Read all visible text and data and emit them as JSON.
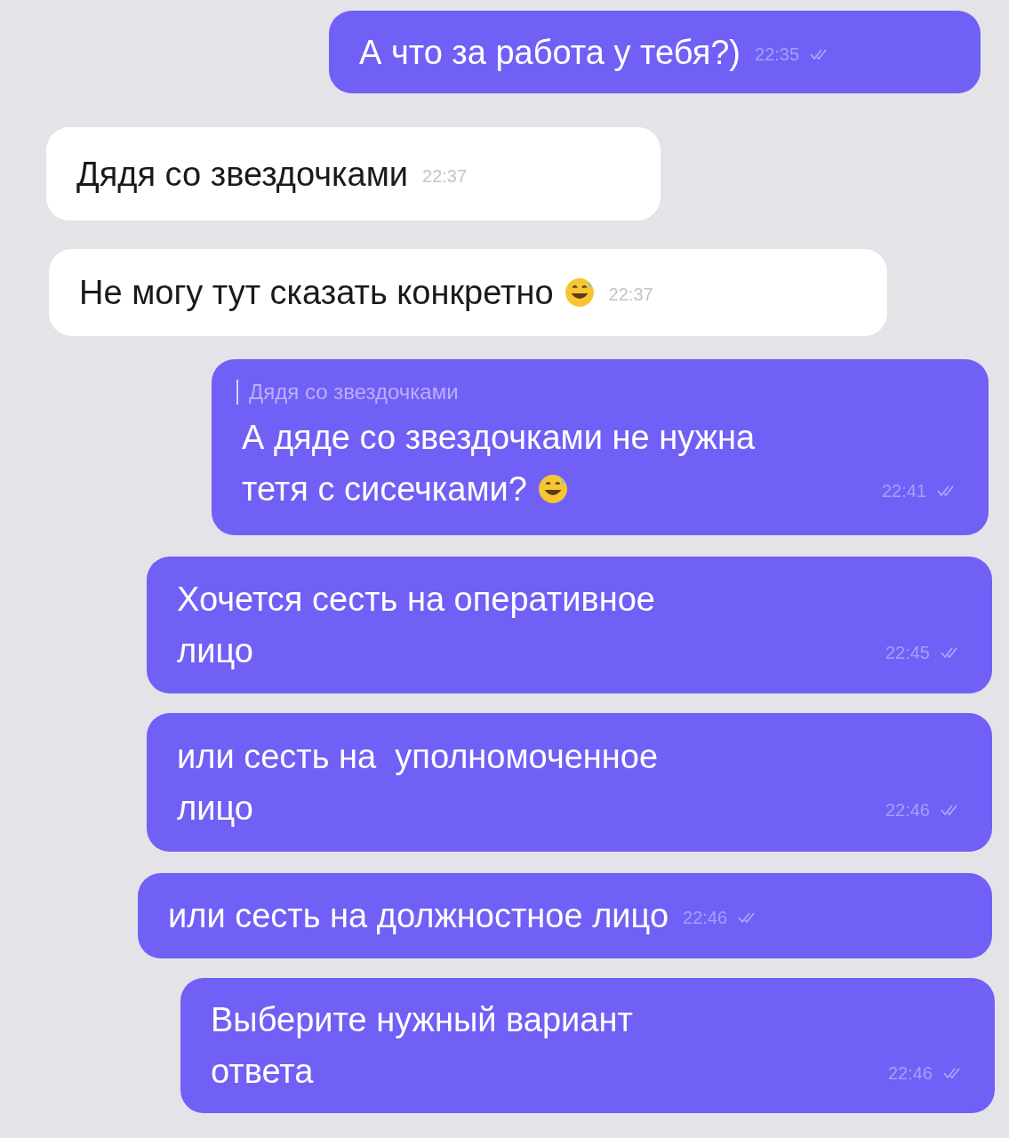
{
  "messages": [
    {
      "outgoing": true,
      "lines": [
        "А что за работа у тебя?)"
      ],
      "time": "22:35",
      "read": true
    },
    {
      "outgoing": false,
      "lines": [
        "Дядя со звездочками"
      ],
      "time": "22:37"
    },
    {
      "outgoing": false,
      "lines": [
        "Не могу тут сказать конкретно"
      ],
      "emoji": true,
      "time": "22:37"
    },
    {
      "outgoing": true,
      "reply_to": "Дядя со звездочками",
      "lines": [
        "А дяде со звездочками не нужна",
        "тетя с сисечками?"
      ],
      "emoji": true,
      "time": "22:41",
      "read": true
    },
    {
      "outgoing": true,
      "lines": [
        "Хочется сесть на оперативное",
        "лицо"
      ],
      "time": "22:45",
      "read": true
    },
    {
      "outgoing": true,
      "lines": [
        "или сесть на  уполномоченное",
        "лицо"
      ],
      "time": "22:46",
      "read": true
    },
    {
      "outgoing": true,
      "lines": [
        "или сесть на должностное лицо"
      ],
      "time": "22:46",
      "read": true
    },
    {
      "outgoing": true,
      "lines": [
        "Выберите нужный вариант",
        "ответа"
      ],
      "time": "22:46",
      "read": true
    }
  ]
}
